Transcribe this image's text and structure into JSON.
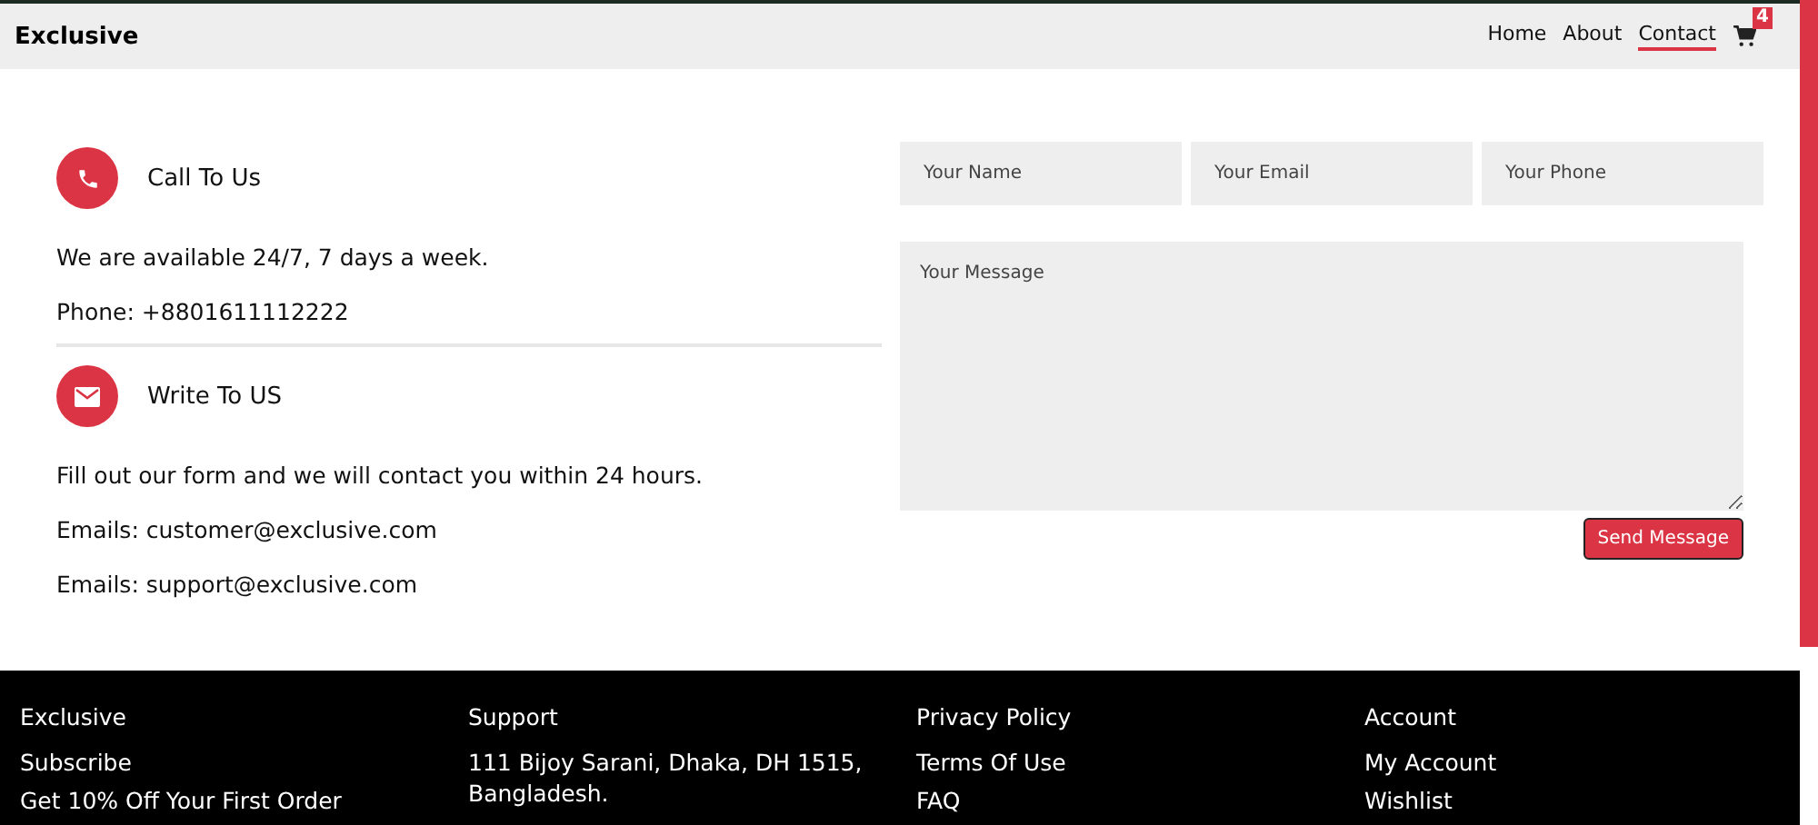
{
  "navbar": {
    "brand": "Exclusive",
    "links": [
      {
        "label": "Home",
        "selected": false
      },
      {
        "label": "About",
        "selected": false
      },
      {
        "label": "Contact",
        "selected": true
      }
    ],
    "cart_count": "4"
  },
  "contact_info": [
    {
      "kind": "phone",
      "title": "Call To Us",
      "lines": [
        "We are available 24/7, 7 days a week.",
        "Phone: +8801611112222"
      ]
    },
    {
      "kind": "mail",
      "title": "Write To US",
      "lines": [
        "Fill out our form and we will contact you within 24 hours.",
        "Emails: customer@exclusive.com",
        "Emails: support@exclusive.com"
      ]
    }
  ],
  "form": {
    "fields": [
      {
        "placeholder": "Your Name"
      },
      {
        "placeholder": "Your Email"
      },
      {
        "placeholder": "Your Phone"
      }
    ],
    "message": {
      "placeholder": "Your Message"
    },
    "submit": "Send Message"
  },
  "footer": {
    "columns": [
      {
        "title": "Exclusive",
        "items": [
          "Subscribe",
          "Get 10% Off Your First Order"
        ]
      },
      {
        "title": "Support",
        "items": [
          "111 Bijoy Sarani, Dhaka, DH 1515, Bangladesh."
        ]
      },
      {
        "title": "Privacy Policy",
        "items": [
          "Terms Of Use",
          "FAQ"
        ]
      },
      {
        "title": "Account",
        "items": [
          "My Account",
          "Wishlist"
        ]
      }
    ]
  }
}
